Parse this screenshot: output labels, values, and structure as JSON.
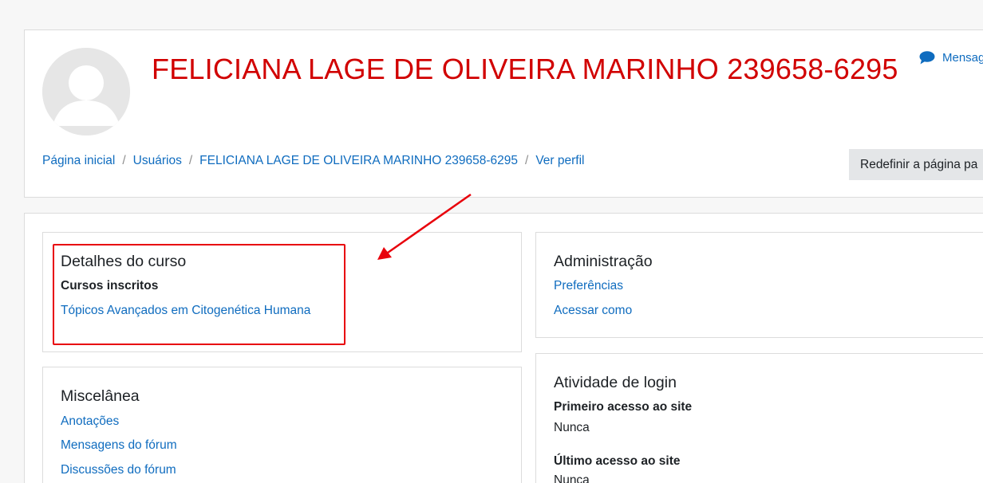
{
  "header": {
    "title": "FELICIANA LAGE DE OLIVEIRA MARINHO 239658-6295",
    "message_label": "Mensag",
    "reset_button_label": "Redefinir a página pa",
    "breadcrumb": [
      "Página inicial",
      "Usuários",
      "FELICIANA LAGE DE OLIVEIRA MARINHO 239658-6295",
      "Ver perfil"
    ]
  },
  "sections": {
    "course_details": {
      "title": "Detalhes do curso",
      "enrolled_label": "Cursos inscritos",
      "courses": [
        "Tópicos Avançados em Citogenética Humana"
      ]
    },
    "miscellaneous": {
      "title": "Miscelânea",
      "links": [
        "Anotações",
        "Mensagens do fórum",
        "Discussões do fórum"
      ]
    },
    "administration": {
      "title": "Administração",
      "links": [
        "Preferências",
        "Acessar como"
      ]
    },
    "login_activity": {
      "title": "Atividade de login",
      "first_access_label": "Primeiro acesso ao site",
      "first_access_value": "Nunca",
      "last_access_label": "Último acesso ao site",
      "last_access_value": "Nunca"
    }
  },
  "colors": {
    "title": "#d10000",
    "link": "#0f6cbf",
    "annotation": "#e8000b"
  },
  "icons": {
    "message": "speech-bubble-icon",
    "avatar": "default-user-avatar"
  }
}
